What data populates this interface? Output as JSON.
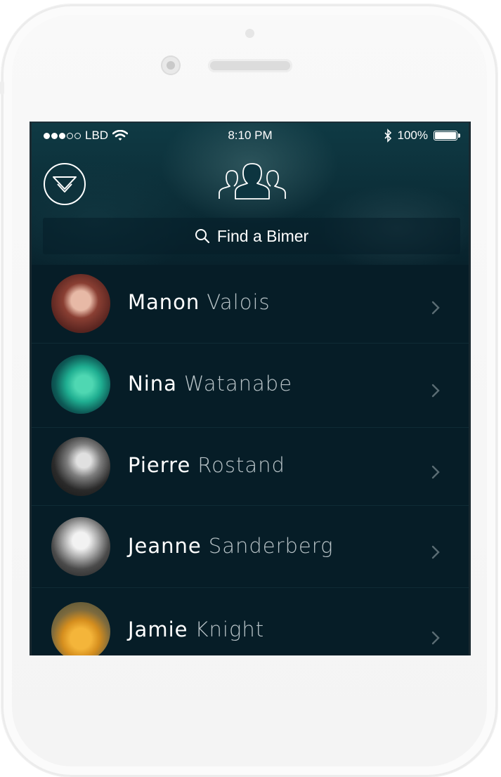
{
  "status_bar": {
    "carrier": "LBD",
    "time": "8:10 PM",
    "battery": "100%"
  },
  "header": {
    "menu_icon": "chevron-down-circle-icon",
    "title_icon": "people-group-icon"
  },
  "search": {
    "label": "Find a Bimer",
    "icon": "search-icon"
  },
  "contacts": [
    {
      "first": "Manon",
      "last": "Valois"
    },
    {
      "first": "Nina",
      "last": "Watanabe"
    },
    {
      "first": "Pierre",
      "last": "Rostand"
    },
    {
      "first": "Jeanne",
      "last": "Sanderberg"
    },
    {
      "first": "Jamie",
      "last": "Knight"
    }
  ],
  "colors": {
    "screen_bg": "#061d27",
    "header_bg": "#0f3a44",
    "text": "#ffffff",
    "muted_text": "#b9c4c8"
  }
}
